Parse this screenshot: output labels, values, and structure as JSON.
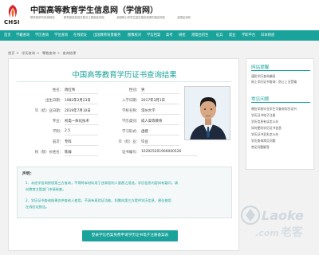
{
  "header": {
    "logo_text": "CHSI",
    "site_title": "中国高等教育学生信息网（学信网）",
    "slogans": [
      "教育部学历查询网站",
      "教育部高校招生阳光工程指定网站",
      "全国硕士研究生招生报名和调剂指定网站",
      "全国征兵网"
    ]
  },
  "nav": {
    "items": [
      "首页",
      "学籍查询",
      "学历查询",
      "学位查询",
      "在线验证",
      "出国教育背景服务",
      "图像校对",
      "学信档案",
      "高考",
      "研招",
      "港澳台招生",
      "征兵",
      "就业",
      "学职平台",
      "日本频道"
    ]
  },
  "breadcrumb": [
    "首页",
    "学历查询",
    "零散查询",
    "查询结果"
  ],
  "result": {
    "title": "中国高等教育学历证书查询结果",
    "fields": [
      {
        "label": "姓名：",
        "value": "周红伟"
      },
      {
        "label": "性别：",
        "value": "男"
      },
      {
        "label": "出生日期：",
        "value": "1982年2月23日"
      },
      {
        "label": "入学日期：",
        "value": "2017年3月1日"
      },
      {
        "label": "毕（结）业日期：",
        "value": "2019年7月10日"
      },
      {
        "label": "学校名称：",
        "value": "常州大学"
      },
      {
        "label": "专业：",
        "value": "机电一体化技术"
      },
      {
        "label": "学历类别：",
        "value": "成人高等教育"
      },
      {
        "label": "学制：",
        "value": "2.5"
      },
      {
        "label": "学习形式：",
        "value": "函授"
      },
      {
        "label": "层次：",
        "value": "专科"
      },
      {
        "label": "毕（结）业：",
        "value": "毕业"
      },
      {
        "label": "校（院）长姓名：",
        "value": "陈群"
      },
      {
        "label": "证书编号：",
        "value": "102925201906000526"
      }
    ]
  },
  "notice": {
    "title": "声明：",
    "lines": [
      "1、未经学信网授权第三方查询，不得将本材料用于违背权利人意愿之用途。学历信息内容如有疑问，请",
      "    向教育主管部门申请核查。",
      "2、学历证书查询结果仅供查询人使用，不具有再验证功能。如需向第三方提供学历信息，建议使用",
      "    在线验证报告。"
    ]
  },
  "register_button": "登录学信档案免费申请学历证书电子注册备案表",
  "sidebar": {
    "sections": [
      {
        "title": "网站提醒",
        "items": [
          "谨防学历查询骗局",
          "网上学历证书查询：防止上当受骗"
        ]
      },
      {
        "title": "常见问题",
        "items": [
          "哪些学校毕业学生可查询学历证书",
          "学历证书电子注册",
          "学历信息有误怎么办",
          "如何更改学历证书信息",
          "学历证书丢失怎么办",
          "学历查询常见问题",
          "常见问题解答"
        ]
      }
    ]
  },
  "watermark": {
    "brand": "Laoke",
    "site": ".com",
    "cn": "老客"
  },
  "colors": {
    "accent": "#1aa39a",
    "logo_red": "#d8262c"
  }
}
